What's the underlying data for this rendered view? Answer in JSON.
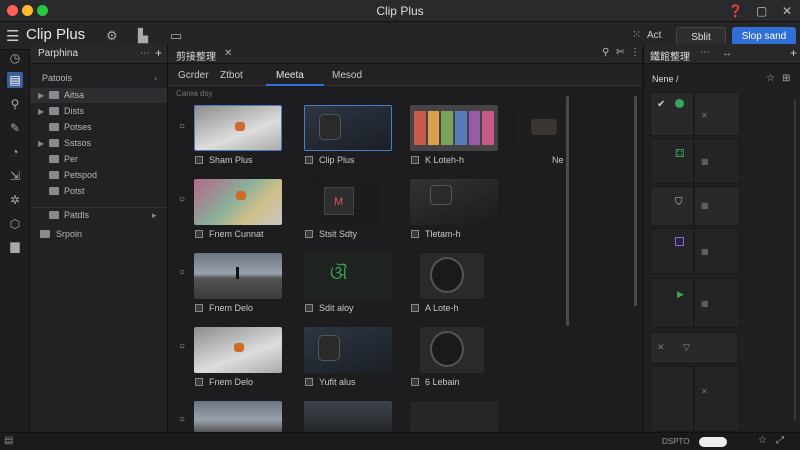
{
  "window": {
    "title": "Clip Plus"
  },
  "toolbar": {
    "app_name": "Clip Plus",
    "act_label": "Act",
    "split_label": "Sblit",
    "save_label": "Slop sand",
    "accent": "#2f6fd6"
  },
  "sidebar": {
    "tab_label": "Parphina",
    "header_label": "Patools",
    "items": [
      {
        "label": "Aitsa"
      },
      {
        "label": "Dists"
      },
      {
        "label": "Potses"
      },
      {
        "label": "Sstsos"
      },
      {
        "label": "Per"
      },
      {
        "label": "Petspod"
      },
      {
        "label": "Potst"
      },
      {
        "label": "Patdls"
      },
      {
        "label": "Srpoin"
      }
    ]
  },
  "main": {
    "tab_label": "剪接整理",
    "subtabs": [
      "Gcrder",
      "Ztbot",
      "Meeta",
      "Mesod"
    ],
    "section_label": "Carea dsy",
    "grid": [
      {
        "caption": "Sham Plus"
      },
      {
        "caption": "Clip Plus"
      },
      {
        "caption": "K Loteh-h"
      },
      {
        "caption": "Ne"
      },
      {
        "caption": "Fnem Cunnat"
      },
      {
        "caption": "Stsit Sdty"
      },
      {
        "caption": "Tletam-h"
      },
      {
        "caption": "Fnem Delo"
      },
      {
        "caption": "Sdit aloy"
      },
      {
        "caption": "A Lote-h"
      },
      {
        "caption": "Fnem Delo"
      },
      {
        "caption": "Yufit alus"
      },
      {
        "caption": "6 Lebain"
      }
    ]
  },
  "right": {
    "tab_label": "鐵館整理",
    "header_label": "Nene /",
    "icons": {
      "check": "✔",
      "gift": "⚃",
      "play": "▶",
      "close": "✕"
    }
  },
  "status": {
    "label": "DSPTO"
  }
}
